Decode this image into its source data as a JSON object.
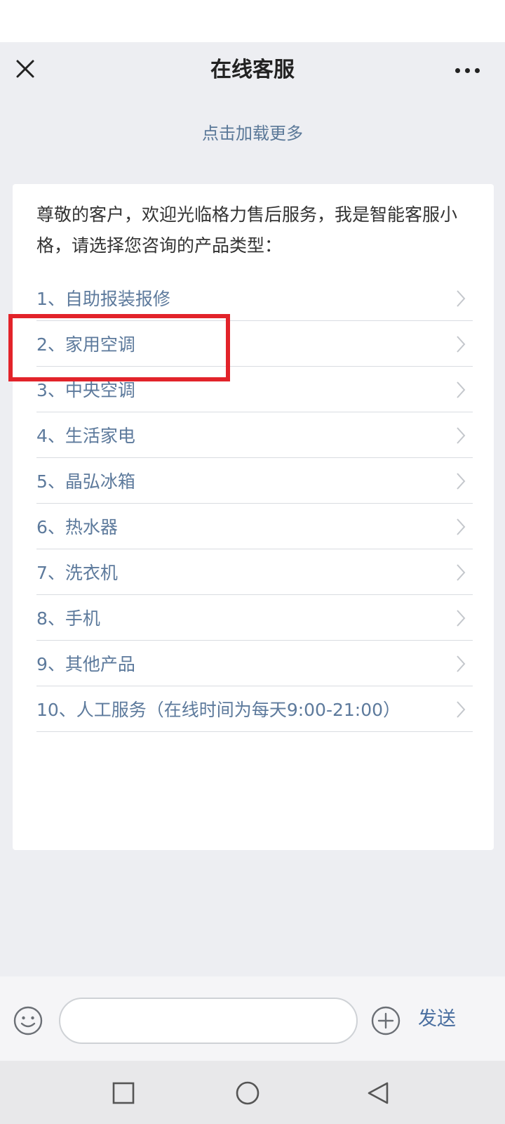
{
  "nav": {
    "title": "在线客服",
    "close_icon": "close-icon",
    "more_icon": "more-dots-icon"
  },
  "chat": {
    "load_more": "点击加载更多",
    "greeting": "尊敬的客户，欢迎光临格力售后服务，我是智能客服小格，请选择您咨询的产品类型：",
    "options": [
      {
        "label": "1、自助报装报修"
      },
      {
        "label": "2、家用空调"
      },
      {
        "label": "3、中央空调"
      },
      {
        "label": "4、生活家电"
      },
      {
        "label": "5、晶弘冰箱"
      },
      {
        "label": "6、热水器"
      },
      {
        "label": "7、洗衣机"
      },
      {
        "label": "8、手机"
      },
      {
        "label": "9、其他产品"
      },
      {
        "label": "10、人工服务（在线时间为每天9:00-21:00）"
      }
    ],
    "highlighted_option": "2、家用空调"
  },
  "input_bar": {
    "placeholder": "",
    "value": "",
    "send_label": "发送",
    "emoji_icon": "emoji-icon",
    "plus_icon": "plus-circle-icon"
  },
  "system_nav": {
    "recents_icon": "square-icon",
    "home_icon": "circle-icon",
    "back_icon": "triangle-back-icon"
  },
  "colors": {
    "background": "#edeef2",
    "option_text": "#5d7a9c",
    "link": "#5a7898",
    "highlight": "#e2232a",
    "send": "#4a6fa0"
  }
}
